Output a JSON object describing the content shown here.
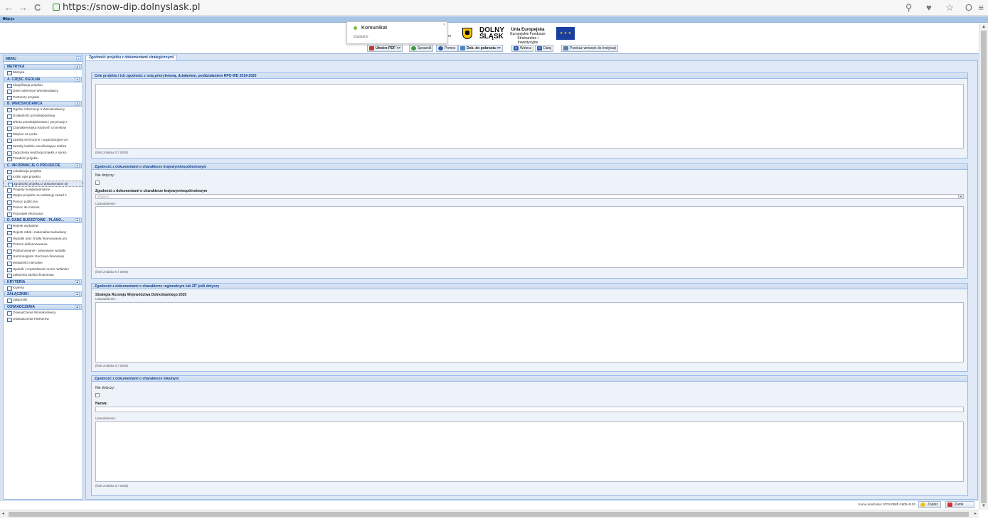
{
  "browser": {
    "back": "←",
    "forward": "→",
    "reload": "C",
    "url": "https://snow-dip.dolnyslask.pl",
    "right_icons": "⚲ ♥ ☆",
    "opera": "O",
    "menu": "≡"
  },
  "window": {
    "title": "Edycja",
    "controls": "⇄ ✕"
  },
  "toast": {
    "title": "Komunikat",
    "message": "Zapisano",
    "close": "×"
  },
  "header": {
    "logo_line1": "DOLNY",
    "logo_line2": "ŚLĄSK",
    "eu_title": "Unia Europejska",
    "eu_sub1": "Europejskie Fundusze",
    "eu_sub2": "Strukturalne i Inwestycyjne",
    "ghost_text": "re"
  },
  "toolbar": {
    "buttons": [
      {
        "label": "Utwórz PDF >>",
        "icon": "pdf-icon"
      },
      {
        "label": "Sprawdź",
        "icon": "check-icon"
      },
      {
        "label": "Pomoc",
        "icon": "help-icon"
      },
      {
        "label": "Dok. do pobrania >>",
        "icon": "download-icon"
      },
      {
        "label": "Wstecz",
        "icon": "back-icon"
      },
      {
        "label": "Dalej",
        "icon": "next-icon"
      },
      {
        "label": "Przekaż wniosek do Instytucji",
        "icon": "send-icon"
      }
    ]
  },
  "sidebar": {
    "title": "MENU",
    "collapse": "«",
    "groups": [
      {
        "title": "METRYKA",
        "items": [
          "Metryka"
        ]
      },
      {
        "title": "A. CZĘŚĆ OGÓLNA",
        "items": [
          "Klasyfikacja projektu",
          "Dane adresowe Wnioskodawcy",
          "Partnerzy projektu"
        ]
      },
      {
        "title": "B. WNIOSKODAWCA",
        "items": [
          "Ogólne informacje o Wnioskodawcy",
          "Działalność przedsiębiorstwa",
          "Oferta przedsiębiorstwa i przychody z",
          "Charakterystyka istotnych czynników",
          "Miejsce na rynku",
          "Zasoby techniczne i organizacyjne um",
          "Zasoby ludzkie umożliwiające realiza",
          "Zagrożenia realizacji projektu i sposo",
          "Trwałość projektu"
        ]
      },
      {
        "title": "C. INFORMACJE O PROJEKCIE",
        "items": [
          "Lokalizacja projektu",
          "Krótki opis projektu",
          "Zgodność projektu z dokumentami str",
          "Projekty komplementarne",
          "Wpływ projektu na realizację zasad h",
          "Pomoc publiczna",
          "Pomoc de minimis",
          "Pozostałe informacje"
        ]
      },
      {
        "title": "D. DANE BUDŻETOWE - PLANO...",
        "items": [
          "Rejestr wydatków",
          "Rejestr robót i materiałów budowlany",
          "Wydatki oraz źródła finansowania pro",
          "Poziom dofinansowania",
          "Podsumowanie - planowane wydatki",
          "Harmonogram rzeczowo-finansowy",
          "Wskaźniki mierzalne",
          "Sposób i częstotliwość monit. Wskaźni",
          "Założenia analiza finansowa"
        ]
      },
      {
        "title": "KRYTERIA",
        "items": [
          "Kryteria"
        ]
      },
      {
        "title": "ZAŁĄCZNIKI",
        "items": [
          "Załączniki"
        ]
      },
      {
        "title": "OŚWIADCZENIA",
        "items": [
          "Oświadczenia Wnioskodawcy",
          "Oświadczenia Partnerów"
        ]
      }
    ]
  },
  "content": {
    "tab": "Zgodność projektu z dokumentami strategicznymi",
    "sections": {
      "s1": {
        "title": "Cele projektu i ich zgodność z osią priorytetową, działaniem, poddziałaniem RPO WD 2014-2020",
        "limit": "(limit znaków 0 / 2000)"
      },
      "s2": {
        "title": "Zgodność z dokumentami o charakterze krajowym/wspólnotowym",
        "na_label": "Nie dotyczy:",
        "select_label": "Zgodność z dokumentami o charakterze krajowym/wspólnotowym",
        "select_value": "Wybierz",
        "just_label": "Uzasadnienie:",
        "limit": "(limit znaków 0 / 2000)"
      },
      "s3": {
        "title": "Zgodność z dokumentami o charakterze regionalnym lub ZIT jeśli dotyczy",
        "strategy": "Strategia Rozwoju Województwa Dolnośląskiego 2020",
        "just_label": "Uzasadnienie:",
        "limit": "(limit znaków 0 / 2000)"
      },
      "s4": {
        "title": "Zgodność z dokumentami o charakterze lokalnym",
        "na_label": "Nie dotyczy:",
        "name_label": "Nazwa:",
        "just_label": "Uzasadnienie:",
        "limit": "(limit znaków 0 / 2000)"
      }
    }
  },
  "footer": {
    "checksum": "Suma kontrolna: 9702-058F-2800-4103",
    "save": "Zapisz",
    "close": "Zamk"
  },
  "colors": {
    "panel_header": "#15428b",
    "border": "#99bbe8",
    "background": "#dfe8f6"
  }
}
